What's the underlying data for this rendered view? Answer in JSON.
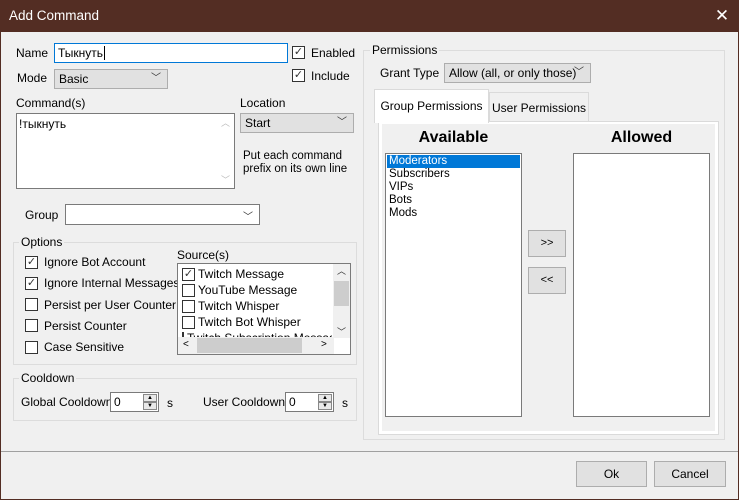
{
  "window": {
    "title": "Add Command",
    "close_icon": "close-icon"
  },
  "form": {
    "name_label": "Name",
    "name_value": "Тыкнуть",
    "enabled_label": "Enabled",
    "enabled_checked": true,
    "include_label": "Include",
    "include_checked": true,
    "mode_label": "Mode",
    "mode_value": "Basic",
    "commands_label": "Command(s)",
    "commands_value": "!тыкнуть",
    "location_label": "Location",
    "location_value": "Start",
    "location_hint_line1": "Put each command",
    "location_hint_line2": "prefix on its own line",
    "group_label": "Group",
    "group_value": ""
  },
  "options": {
    "title": "Options",
    "checkboxes": [
      {
        "label": "Ignore Bot Account",
        "checked": true
      },
      {
        "label": "Ignore Internal Messages",
        "checked": true
      },
      {
        "label": "Persist per User Counter",
        "checked": false
      },
      {
        "label": "Persist Counter",
        "checked": false
      },
      {
        "label": "Case Sensitive",
        "checked": false
      }
    ],
    "sources_label": "Source(s)",
    "sources": [
      {
        "label": "Twitch Message",
        "checked": true
      },
      {
        "label": "YouTube Message",
        "checked": false
      },
      {
        "label": "Twitch Whisper",
        "checked": false
      },
      {
        "label": "Twitch Bot Whisper",
        "checked": false
      },
      {
        "label": "Twitch Subscription Message",
        "checked": false
      }
    ]
  },
  "cooldown": {
    "title": "Cooldown",
    "global_label": "Global Cooldown",
    "global_value": "0",
    "user_label": "User Cooldown",
    "user_value": "0",
    "unit": "s"
  },
  "permissions": {
    "title": "Permissions",
    "grant_type_label": "Grant Type",
    "grant_type_value": "Allow (all, or only those)",
    "tabs": [
      {
        "label": "Group Permissions",
        "active": true
      },
      {
        "label": "User Permissions",
        "active": false
      }
    ],
    "available_header": "Available",
    "allowed_header": "Allowed",
    "available": [
      "Moderators",
      "Subscribers",
      "VIPs",
      "Bots",
      "Mods"
    ],
    "selected_available": "Moderators",
    "allowed": [],
    "add_label": ">>",
    "remove_label": "<<"
  },
  "footer": {
    "ok_label": "Ok",
    "cancel_label": "Cancel"
  },
  "colors": {
    "titlebar": "#532d23",
    "selection": "#0078d7",
    "background": "#f0f0f0"
  }
}
